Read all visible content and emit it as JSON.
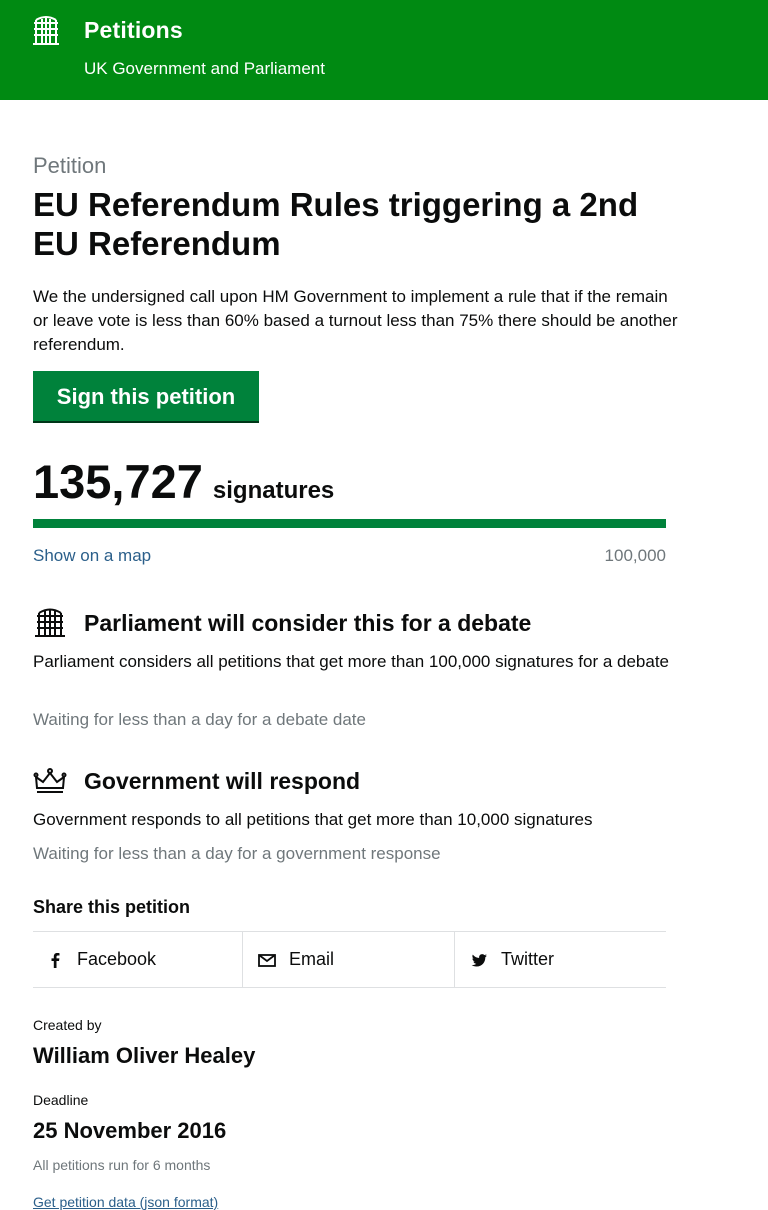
{
  "header": {
    "title": "Petitions",
    "subtitle": "UK Government and Parliament",
    "background": "#008a12",
    "icon": "portcullis-icon"
  },
  "petition": {
    "eyebrow": "Petition",
    "title": "EU Referendum Rules triggering a 2nd EU Referendum",
    "action": "We the undersigned call upon HM Government to implement a rule that if the remain or leave vote is less than 60% based a turnout less than 75% there should be another referendum.",
    "sign_label": "Sign this petition"
  },
  "signatures": {
    "count": "135,727",
    "label": "signatures",
    "threshold": "100,000",
    "progress_percent": 100,
    "map_link": "Show on a map"
  },
  "debate": {
    "icon": "portcullis-icon",
    "title": "Parliament will consider this for a debate",
    "body": "Parliament considers all petitions that get more than 100,000 signatures for a debate",
    "status": "Waiting for less than a day for a debate date"
  },
  "response": {
    "icon": "crown-icon",
    "title": "Government will respond",
    "body": "Government responds to all petitions that get more than 10,000 signatures",
    "status": "Waiting for less than a day for a government response"
  },
  "share": {
    "heading": "Share this petition",
    "items": [
      {
        "label": "Facebook",
        "icon": "facebook-icon"
      },
      {
        "label": "Email",
        "icon": "email-icon"
      },
      {
        "label": "Twitter",
        "icon": "twitter-icon"
      }
    ]
  },
  "meta": {
    "created_label": "Created by",
    "creator": "William Oliver Healey",
    "deadline_label": "Deadline",
    "deadline": "25 November 2016",
    "deadline_note": "All petitions run for 6 months",
    "data_link": "Get petition data (json format)"
  },
  "colors": {
    "green": "#00823b",
    "link": "#2b5f8a",
    "secondary_text": "#6f777b"
  }
}
